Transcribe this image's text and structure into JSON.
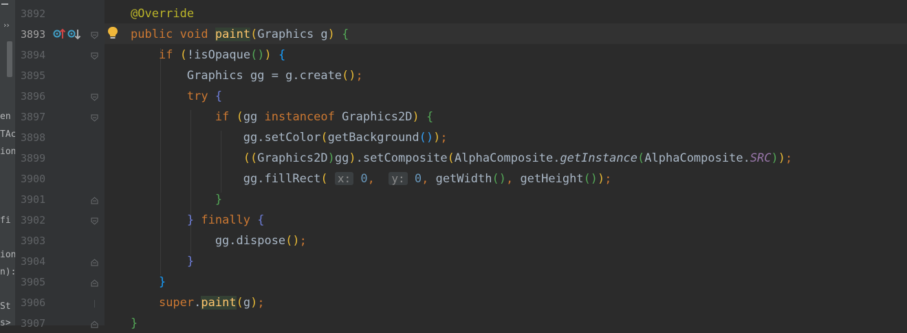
{
  "sidebar": {
    "fragments": [
      "en",
      "TAc",
      "ion",
      "fi",
      "ion",
      "n):",
      "St",
      "s>"
    ]
  },
  "lines": [
    {
      "num": "3892",
      "tokens": [
        {
          "t": "@Override",
          "c": "an"
        }
      ]
    },
    {
      "num": "3893",
      "tokens": [
        {
          "t": "public",
          "c": "kw"
        },
        {
          "t": " ",
          "c": "pu"
        },
        {
          "t": "void",
          "c": "kw"
        },
        {
          "t": " ",
          "c": "pu"
        },
        {
          "t": "caret",
          "c": "caret"
        },
        {
          "t": "paint",
          "c": "fn hl"
        },
        {
          "t": "(",
          "c": "p1"
        },
        {
          "t": "Graphics g",
          "c": "id"
        },
        {
          "t": ")",
          "c": "p1"
        },
        {
          "t": " ",
          "c": "pu"
        },
        {
          "t": "{",
          "c": "p2"
        }
      ]
    },
    {
      "num": "3894",
      "tokens": [
        {
          "t": "    ",
          "c": "pu"
        },
        {
          "t": "if",
          "c": "kw"
        },
        {
          "t": " ",
          "c": "pu"
        },
        {
          "t": "(",
          "c": "p1"
        },
        {
          "t": "!isOpaque",
          "c": "id"
        },
        {
          "t": "()",
          "c": "p2"
        },
        {
          "t": ")",
          "c": "p1"
        },
        {
          "t": " ",
          "c": "pu"
        },
        {
          "t": "{",
          "c": "p5"
        }
      ]
    },
    {
      "num": "3895",
      "tokens": [
        {
          "t": "        Graphics gg = g.create",
          "c": "id"
        },
        {
          "t": "()",
          "c": "p1"
        },
        {
          "t": ";",
          "c": "kw"
        }
      ]
    },
    {
      "num": "3896",
      "tokens": [
        {
          "t": "        ",
          "c": "pu"
        },
        {
          "t": "try",
          "c": "kw"
        },
        {
          "t": " ",
          "c": "pu"
        },
        {
          "t": "{",
          "c": "p4"
        }
      ]
    },
    {
      "num": "3897",
      "tokens": [
        {
          "t": "            ",
          "c": "pu"
        },
        {
          "t": "if",
          "c": "kw"
        },
        {
          "t": " ",
          "c": "pu"
        },
        {
          "t": "(",
          "c": "p1"
        },
        {
          "t": "gg ",
          "c": "id"
        },
        {
          "t": "instanceof",
          "c": "kw"
        },
        {
          "t": " Graphics2D",
          "c": "id"
        },
        {
          "t": ")",
          "c": "p1"
        },
        {
          "t": " ",
          "c": "pu"
        },
        {
          "t": "{",
          "c": "p2"
        }
      ]
    },
    {
      "num": "3898",
      "tokens": [
        {
          "t": "                gg.setColor",
          "c": "id"
        },
        {
          "t": "(",
          "c": "p1"
        },
        {
          "t": "getBackground",
          "c": "id"
        },
        {
          "t": "()",
          "c": "p3"
        },
        {
          "t": ")",
          "c": "p1"
        },
        {
          "t": ";",
          "c": "kw"
        }
      ]
    },
    {
      "num": "3899",
      "tokens": [
        {
          "t": "                ",
          "c": "pu"
        },
        {
          "t": "((",
          "c": "p1"
        },
        {
          "t": "Graphics2D",
          "c": "id"
        },
        {
          "t": ")",
          "c": "p2"
        },
        {
          "t": "gg",
          "c": "id"
        },
        {
          "t": ")",
          "c": "p1"
        },
        {
          "t": ".setComposite",
          "c": "id"
        },
        {
          "t": "(",
          "c": "p1"
        },
        {
          "t": "AlphaComposite.",
          "c": "id"
        },
        {
          "t": "getInstance",
          "c": "id it"
        },
        {
          "t": "(",
          "c": "p2"
        },
        {
          "t": "AlphaComposite.",
          "c": "id"
        },
        {
          "t": "SRC",
          "c": "stat"
        },
        {
          "t": ")",
          "c": "p2"
        },
        {
          "t": ")",
          "c": "p1"
        },
        {
          "t": ";",
          "c": "kw"
        }
      ]
    },
    {
      "num": "3900",
      "tokens": [
        {
          "t": "                gg.fillRect",
          "c": "id"
        },
        {
          "t": "(",
          "c": "p1"
        },
        {
          "t": " ",
          "c": "pu"
        },
        {
          "t": "x:",
          "c": "hint"
        },
        {
          "t": " ",
          "c": "pu"
        },
        {
          "t": "0",
          "c": "num"
        },
        {
          "t": ",  ",
          "c": "kw"
        },
        {
          "t": "y:",
          "c": "hint"
        },
        {
          "t": " ",
          "c": "pu"
        },
        {
          "t": "0",
          "c": "num"
        },
        {
          "t": ", ",
          "c": "kw"
        },
        {
          "t": "getWidth",
          "c": "id"
        },
        {
          "t": "()",
          "c": "p2"
        },
        {
          "t": ", ",
          "c": "kw"
        },
        {
          "t": "getHeight",
          "c": "id"
        },
        {
          "t": "()",
          "c": "p2"
        },
        {
          "t": ")",
          "c": "p1"
        },
        {
          "t": ";",
          "c": "kw"
        }
      ]
    },
    {
      "num": "3901",
      "tokens": [
        {
          "t": "            ",
          "c": "pu"
        },
        {
          "t": "}",
          "c": "p2"
        }
      ]
    },
    {
      "num": "3902",
      "tokens": [
        {
          "t": "        ",
          "c": "pu"
        },
        {
          "t": "}",
          "c": "p4"
        },
        {
          "t": " ",
          "c": "pu"
        },
        {
          "t": "finally",
          "c": "kw"
        },
        {
          "t": " ",
          "c": "pu"
        },
        {
          "t": "{",
          "c": "p4"
        }
      ]
    },
    {
      "num": "3903",
      "tokens": [
        {
          "t": "            gg.dispose",
          "c": "id"
        },
        {
          "t": "()",
          "c": "p1"
        },
        {
          "t": ";",
          "c": "kw"
        }
      ]
    },
    {
      "num": "3904",
      "tokens": [
        {
          "t": "        ",
          "c": "pu"
        },
        {
          "t": "}",
          "c": "p4"
        }
      ]
    },
    {
      "num": "3905",
      "tokens": [
        {
          "t": "    ",
          "c": "pu"
        },
        {
          "t": "}",
          "c": "p5"
        }
      ]
    },
    {
      "num": "3906",
      "tokens": [
        {
          "t": "    ",
          "c": "pu"
        },
        {
          "t": "super",
          "c": "kw"
        },
        {
          "t": ".",
          "c": "id"
        },
        {
          "t": "paint",
          "c": "fn hl"
        },
        {
          "t": "(",
          "c": "p1"
        },
        {
          "t": "g",
          "c": "id"
        },
        {
          "t": ")",
          "c": "p1"
        },
        {
          "t": ";",
          "c": "kw"
        }
      ]
    },
    {
      "num": "3907",
      "tokens": [
        {
          "t": "}",
          "c": "p2"
        }
      ]
    }
  ],
  "icons": {
    "override_up": "override-up-icon",
    "override_down": "override-down-icon",
    "bulb": "bulb-icon"
  },
  "colors": {
    "background": "#2b2b2b",
    "gutter": "#313335",
    "current_line": "#323232"
  }
}
